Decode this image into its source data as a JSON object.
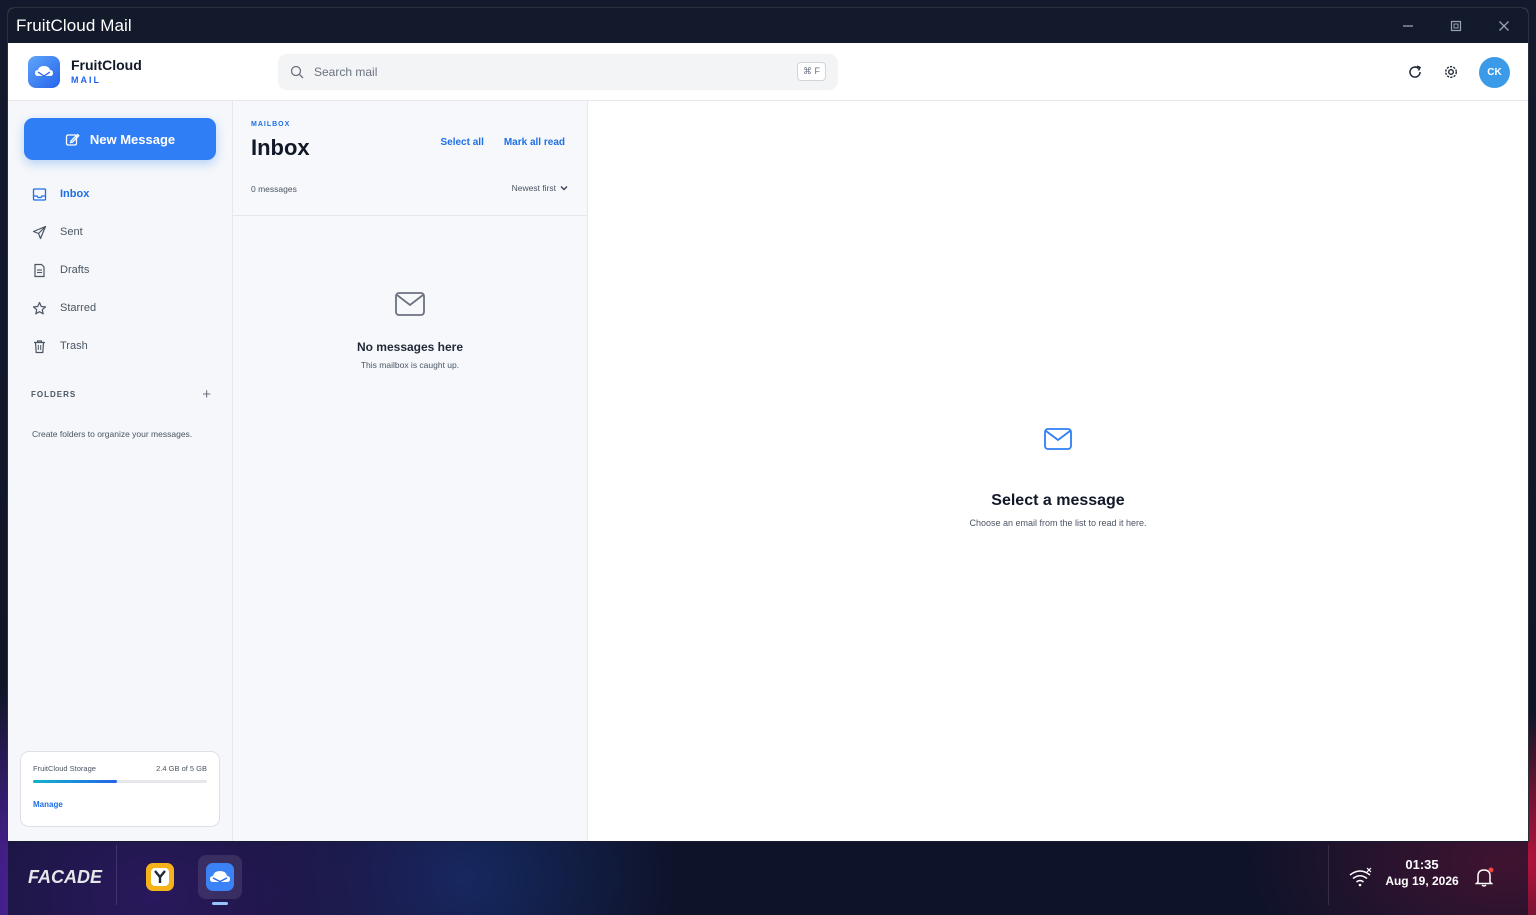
{
  "window": {
    "title": "FruitCloud Mail"
  },
  "brand": {
    "name": "FruitCloud",
    "sub": "MAIL"
  },
  "search": {
    "placeholder": "Search mail",
    "shortcut": "⌘ F"
  },
  "user": {
    "initials": "CK"
  },
  "compose": {
    "label": "New Message"
  },
  "nav": [
    {
      "label": "Inbox",
      "active": true,
      "icon": "inbox-icon"
    },
    {
      "label": "Sent",
      "icon": "send-icon"
    },
    {
      "label": "Drafts",
      "icon": "draft-icon"
    },
    {
      "label": "Starred",
      "icon": "star-icon"
    },
    {
      "label": "Trash",
      "icon": "trash-icon"
    }
  ],
  "folders": {
    "label": "FOLDERS",
    "add": "+",
    "empty": "Create folders to organize your messages."
  },
  "storage": {
    "label": "FruitCloud Storage",
    "usage": "2.4 GB of 5 GB",
    "used_fraction": 0.48,
    "manage": "Manage"
  },
  "list": {
    "kicker": "MAILBOX",
    "title": "Inbox",
    "select_all": "Select all",
    "mark_all_read": "Mark all read",
    "count": "0 messages",
    "sort": "Newest first",
    "empty_title": "No messages here",
    "empty_sub": "This mailbox is caught up."
  },
  "reader": {
    "title": "Select a message",
    "sub": "Choose an email from the list to read it here."
  },
  "taskbar": {
    "launcher": "FACADE",
    "time": "01:35",
    "date": "Aug 19, 2026"
  },
  "colors": {
    "accent": "#2f7ef6",
    "titlebar": "#131a2b"
  }
}
